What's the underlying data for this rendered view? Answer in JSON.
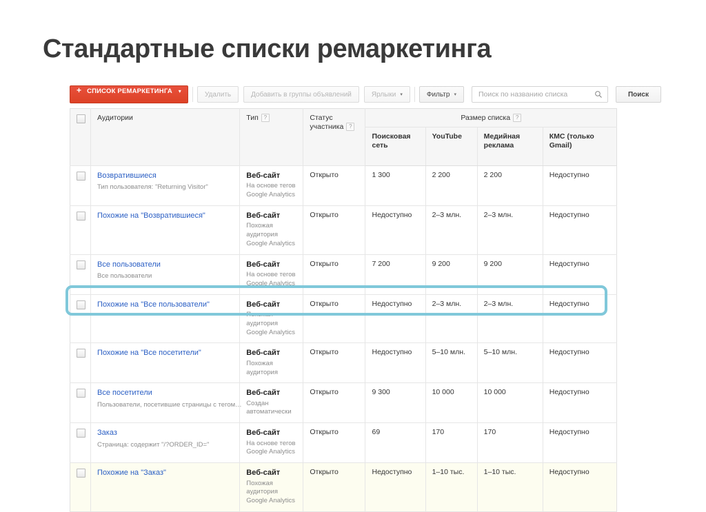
{
  "page": {
    "title": "Стандартные списки ремаркетинга"
  },
  "toolbar": {
    "primary_button": "СПИСОК РЕМАРКЕТИНГА",
    "primary_caret": "▾",
    "delete_button": "Удалить",
    "add_to_adgroups_button": "Добавить в группы объявлений",
    "labels_button": "Ярлыки",
    "filter_button": "Фильтр",
    "caret": "▾",
    "search_placeholder": "Поиск по названию списка",
    "search_value": "",
    "search_button": "Поиск",
    "search_icon": "search-icon"
  },
  "table": {
    "headers": {
      "select_all": "",
      "audiences": "Аудитории",
      "type": "Тип",
      "member_status": "Статус участника",
      "list_size_group": "Размер списка",
      "hint_marker": "?",
      "sub": {
        "search_network": "Поисковая сеть",
        "youtube": "YouTube",
        "display": "Медийная реклама",
        "gmail": "КМС (только Gmail)"
      }
    },
    "rows": [
      {
        "name": "Возвратившиеся",
        "description": "Тип пользователя: \"Returning Visitor\"",
        "type_main": "Веб-сайт",
        "type_sub_1": "На основе тегов",
        "type_sub_2": "Google Analytics",
        "status": "Открыто",
        "search_network": "1 300",
        "youtube": "2 200",
        "display": "2 200",
        "gmail": "Недоступно",
        "highlighted": false,
        "shaded": false
      },
      {
        "name": "Похожие на \"Возвратившиеся\"",
        "description": "",
        "type_main": "Веб-сайт",
        "type_sub_1": "Похожая аудитория",
        "type_sub_2": "Google Analytics",
        "status": "Открыто",
        "search_network": "Недоступно",
        "youtube": "2–3 млн.",
        "display": "2–3 млн.",
        "gmail": "Недоступно",
        "highlighted": false,
        "shaded": false
      },
      {
        "name": "Все пользователи",
        "description": "Все пользователи",
        "type_main": "Веб-сайт",
        "type_sub_1": "На основе тегов",
        "type_sub_2": "Google Analytics",
        "status": "Открыто",
        "search_network": "7 200",
        "youtube": "9 200",
        "display": "9 200",
        "gmail": "Недоступно",
        "highlighted": false,
        "shaded": false
      },
      {
        "name": "Похожие на \"Все пользователи\"",
        "description": "",
        "type_main": "Веб-сайт",
        "type_sub_1": "Похожая аудитория",
        "type_sub_2": "Google Analytics",
        "status": "Открыто",
        "search_network": "Недоступно",
        "youtube": "2–3 млн.",
        "display": "2–3 млн.",
        "gmail": "Недоступно",
        "highlighted": false,
        "shaded": false
      },
      {
        "name": "Похожие на \"Все посетители\"",
        "description": "",
        "type_main": "Веб-сайт",
        "type_sub_1": "Похожая аудитория",
        "type_sub_2": "",
        "status": "Открыто",
        "search_network": "Недоступно",
        "youtube": "5–10 млн.",
        "display": "5–10 млн.",
        "gmail": "Недоступно",
        "highlighted": false,
        "shaded": false
      },
      {
        "name": "Все посетители",
        "description": "Пользователи, посетившие страницы с тегом…",
        "type_main": "Веб-сайт",
        "type_sub_1": "Создан автоматически",
        "type_sub_2": "",
        "status": "Открыто",
        "search_network": "9 300",
        "youtube": "10 000",
        "display": "10 000",
        "gmail": "Недоступно",
        "highlighted": true,
        "shaded": false
      },
      {
        "name": "Заказ",
        "description": "Страница: содержит \"/?ORDER_ID=\"",
        "type_main": "Веб-сайт",
        "type_sub_1": "На основе тегов",
        "type_sub_2": "Google Analytics",
        "status": "Открыто",
        "search_network": "69",
        "youtube": "170",
        "display": "170",
        "gmail": "Недоступно",
        "highlighted": false,
        "shaded": false
      },
      {
        "name": "Похожие на \"Заказ\"",
        "description": "",
        "type_main": "Веб-сайт",
        "type_sub_1": "Похожая аудитория",
        "type_sub_2": "Google Analytics",
        "status": "Открыто",
        "search_network": "Недоступно",
        "youtube": "1–10 тыс.",
        "display": "1–10 тыс.",
        "gmail": "Недоступно",
        "highlighted": false,
        "shaded": true
      }
    ]
  },
  "colors": {
    "primary_red": "#dd4226",
    "link_blue": "#2b5fc4",
    "highlight_ring": "#80c8da",
    "row_shade": "#fdfdf0"
  }
}
